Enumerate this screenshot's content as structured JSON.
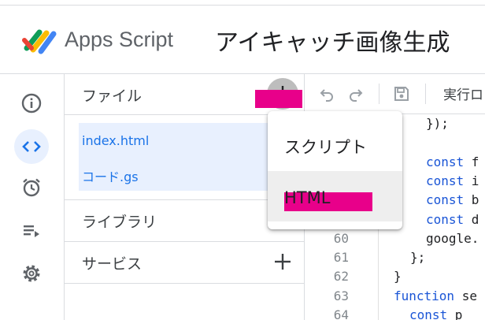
{
  "header": {
    "brand": "Apps Script",
    "project_title": "アイキャッチ画像生成"
  },
  "rail": {
    "items": [
      "overview-icon",
      "editor-icon",
      "triggers-icon",
      "executions-icon",
      "settings-icon"
    ],
    "active": "editor"
  },
  "files_panel": {
    "files_title": "ファイル",
    "files": [
      "index.html",
      "コード.gs"
    ],
    "libraries_title": "ライブラリ",
    "services_title": "サービス"
  },
  "add_menu": {
    "items": [
      "スクリプト",
      "HTML"
    ],
    "highlighted": "HTML"
  },
  "toolbar": {
    "run_label": "実行ロ"
  },
  "code": {
    "lines": [
      {
        "n": "",
        "text": "});"
      },
      {
        "n": "",
        "text": ""
      },
      {
        "n": "",
        "kw": "const",
        "text": " f"
      },
      {
        "n": "",
        "kw": "const",
        "text": " i"
      },
      {
        "n": "",
        "kw": "const",
        "text": " b"
      },
      {
        "n": "",
        "kw": "const",
        "text": " d"
      },
      {
        "n": "60",
        "text": "google."
      },
      {
        "n": "61",
        "text": "};"
      },
      {
        "n": "62",
        "text": "}"
      },
      {
        "n": "63",
        "kw": "function",
        "text": " se"
      },
      {
        "n": "64",
        "kw": "const",
        "text": " p"
      }
    ]
  },
  "colors": {
    "accent": "#1a73e8",
    "selection": "#e8f0fe",
    "annotation_mark": "#e8008a",
    "keyword": "#1a55d6"
  }
}
